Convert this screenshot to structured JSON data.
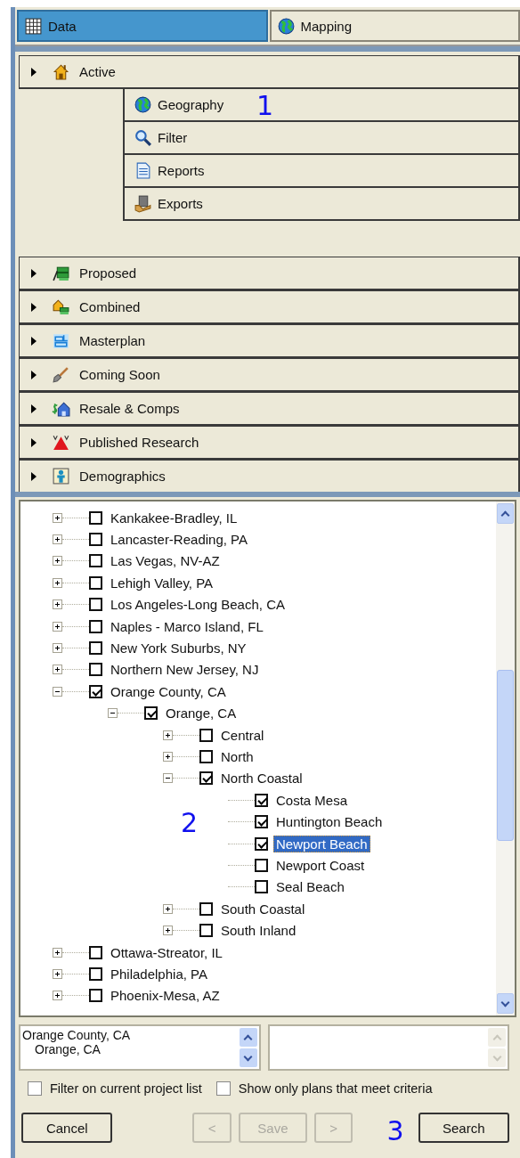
{
  "tabs": [
    {
      "label": "Data",
      "selected": true
    },
    {
      "label": "Mapping",
      "selected": false
    }
  ],
  "groups": [
    {
      "label": "Active",
      "items": [
        {
          "label": "Geography"
        },
        {
          "label": "Filter"
        },
        {
          "label": "Reports"
        },
        {
          "label": "Exports"
        }
      ]
    },
    {
      "label": "Proposed"
    },
    {
      "label": "Combined"
    },
    {
      "label": "Masterplan"
    },
    {
      "label": "Coming Soon"
    },
    {
      "label": "Resale & Comps"
    },
    {
      "label": "Published Research"
    },
    {
      "label": "Demographics"
    }
  ],
  "geography_callout": "1",
  "tree": {
    "items": [
      {
        "label": "Kankakee-Bradley, IL",
        "checked": false,
        "selected": false,
        "expanded": false
      },
      {
        "label": "Lancaster-Reading, PA",
        "checked": false,
        "selected": false,
        "expanded": false
      },
      {
        "label": "Las Vegas, NV-AZ",
        "checked": false,
        "selected": false,
        "expanded": false
      },
      {
        "label": "Lehigh Valley, PA",
        "checked": false,
        "selected": false,
        "expanded": false
      },
      {
        "label": "Los Angeles-Long Beach, CA",
        "checked": false,
        "selected": false,
        "expanded": false
      },
      {
        "label": "Naples - Marco Island, FL",
        "checked": false,
        "selected": false,
        "expanded": false
      },
      {
        "label": "New York Suburbs, NY",
        "checked": false,
        "selected": false,
        "expanded": false
      },
      {
        "label": "Northern New Jersey, NJ",
        "checked": false,
        "selected": false,
        "expanded": false
      },
      {
        "label": "Orange County, CA",
        "checked": true,
        "selected": false,
        "expanded": true,
        "children": [
          {
            "label": "Orange, CA",
            "checked": true,
            "selected": false,
            "expanded": true,
            "children": [
              {
                "label": "Central",
                "checked": false,
                "selected": false,
                "expanded": false
              },
              {
                "label": "North",
                "checked": false,
                "selected": false,
                "expanded": false
              },
              {
                "label": "North Coastal",
                "checked": true,
                "selected": false,
                "expanded": true,
                "children": [
                  {
                    "label": "Costa Mesa",
                    "checked": true,
                    "selected": false
                  },
                  {
                    "label": "Huntington Beach",
                    "checked": true,
                    "selected": false
                  },
                  {
                    "label": "Newport Beach",
                    "checked": true,
                    "selected": true
                  },
                  {
                    "label": "Newport Coast",
                    "checked": false,
                    "selected": false
                  },
                  {
                    "label": "Seal Beach",
                    "checked": false,
                    "selected": false
                  }
                ]
              },
              {
                "label": "South Coastal",
                "checked": false,
                "selected": false,
                "expanded": false
              },
              {
                "label": "South Inland",
                "checked": false,
                "selected": false,
                "expanded": false
              }
            ]
          }
        ]
      },
      {
        "label": "Ottawa-Streator, IL",
        "checked": false,
        "selected": false,
        "expanded": false
      },
      {
        "label": "Philadelphia, PA",
        "checked": false,
        "selected": false,
        "expanded": false
      },
      {
        "label": "Phoenix-Mesa, AZ",
        "checked": false,
        "selected": false,
        "expanded": false
      }
    ]
  },
  "tree_callout": "2",
  "selection_lists": [
    {
      "disabled": false,
      "items": [
        {
          "label": "Orange County, CA",
          "children": [
            {
              "label": "Orange, CA"
            }
          ]
        }
      ]
    },
    {
      "disabled": true
    }
  ],
  "options": [
    {
      "label": "Filter on current project list",
      "checked": false
    },
    {
      "label": "Show only plans that meet criteria",
      "checked": false
    }
  ],
  "buttons": [
    {
      "label": "Cancel",
      "disabled": false
    },
    {
      "label": "<",
      "disabled": true
    },
    {
      "label": "Save",
      "disabled": true
    },
    {
      "label": ">",
      "disabled": true
    },
    {
      "label": "Search",
      "disabled": false
    }
  ],
  "search_callout": "3"
}
